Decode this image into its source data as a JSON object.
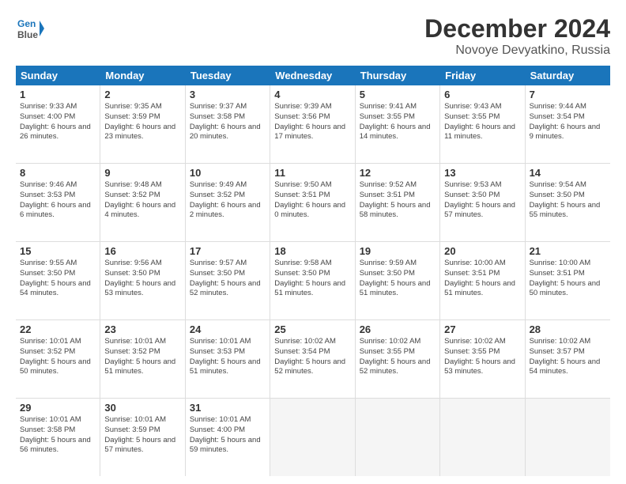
{
  "header": {
    "logo_line1": "General",
    "logo_line2": "Blue",
    "month_title": "December 2024",
    "location": "Novoye Devyatkino, Russia"
  },
  "weekdays": [
    "Sunday",
    "Monday",
    "Tuesday",
    "Wednesday",
    "Thursday",
    "Friday",
    "Saturday"
  ],
  "rows": [
    [
      {
        "day": "1",
        "sunrise": "Sunrise: 9:33 AM",
        "sunset": "Sunset: 4:00 PM",
        "daylight": "Daylight: 6 hours and 26 minutes."
      },
      {
        "day": "2",
        "sunrise": "Sunrise: 9:35 AM",
        "sunset": "Sunset: 3:59 PM",
        "daylight": "Daylight: 6 hours and 23 minutes."
      },
      {
        "day": "3",
        "sunrise": "Sunrise: 9:37 AM",
        "sunset": "Sunset: 3:58 PM",
        "daylight": "Daylight: 6 hours and 20 minutes."
      },
      {
        "day": "4",
        "sunrise": "Sunrise: 9:39 AM",
        "sunset": "Sunset: 3:56 PM",
        "daylight": "Daylight: 6 hours and 17 minutes."
      },
      {
        "day": "5",
        "sunrise": "Sunrise: 9:41 AM",
        "sunset": "Sunset: 3:55 PM",
        "daylight": "Daylight: 6 hours and 14 minutes."
      },
      {
        "day": "6",
        "sunrise": "Sunrise: 9:43 AM",
        "sunset": "Sunset: 3:55 PM",
        "daylight": "Daylight: 6 hours and 11 minutes."
      },
      {
        "day": "7",
        "sunrise": "Sunrise: 9:44 AM",
        "sunset": "Sunset: 3:54 PM",
        "daylight": "Daylight: 6 hours and 9 minutes."
      }
    ],
    [
      {
        "day": "8",
        "sunrise": "Sunrise: 9:46 AM",
        "sunset": "Sunset: 3:53 PM",
        "daylight": "Daylight: 6 hours and 6 minutes."
      },
      {
        "day": "9",
        "sunrise": "Sunrise: 9:48 AM",
        "sunset": "Sunset: 3:52 PM",
        "daylight": "Daylight: 6 hours and 4 minutes."
      },
      {
        "day": "10",
        "sunrise": "Sunrise: 9:49 AM",
        "sunset": "Sunset: 3:52 PM",
        "daylight": "Daylight: 6 hours and 2 minutes."
      },
      {
        "day": "11",
        "sunrise": "Sunrise: 9:50 AM",
        "sunset": "Sunset: 3:51 PM",
        "daylight": "Daylight: 6 hours and 0 minutes."
      },
      {
        "day": "12",
        "sunrise": "Sunrise: 9:52 AM",
        "sunset": "Sunset: 3:51 PM",
        "daylight": "Daylight: 5 hours and 58 minutes."
      },
      {
        "day": "13",
        "sunrise": "Sunrise: 9:53 AM",
        "sunset": "Sunset: 3:50 PM",
        "daylight": "Daylight: 5 hours and 57 minutes."
      },
      {
        "day": "14",
        "sunrise": "Sunrise: 9:54 AM",
        "sunset": "Sunset: 3:50 PM",
        "daylight": "Daylight: 5 hours and 55 minutes."
      }
    ],
    [
      {
        "day": "15",
        "sunrise": "Sunrise: 9:55 AM",
        "sunset": "Sunset: 3:50 PM",
        "daylight": "Daylight: 5 hours and 54 minutes."
      },
      {
        "day": "16",
        "sunrise": "Sunrise: 9:56 AM",
        "sunset": "Sunset: 3:50 PM",
        "daylight": "Daylight: 5 hours and 53 minutes."
      },
      {
        "day": "17",
        "sunrise": "Sunrise: 9:57 AM",
        "sunset": "Sunset: 3:50 PM",
        "daylight": "Daylight: 5 hours and 52 minutes."
      },
      {
        "day": "18",
        "sunrise": "Sunrise: 9:58 AM",
        "sunset": "Sunset: 3:50 PM",
        "daylight": "Daylight: 5 hours and 51 minutes."
      },
      {
        "day": "19",
        "sunrise": "Sunrise: 9:59 AM",
        "sunset": "Sunset: 3:50 PM",
        "daylight": "Daylight: 5 hours and 51 minutes."
      },
      {
        "day": "20",
        "sunrise": "Sunrise: 10:00 AM",
        "sunset": "Sunset: 3:51 PM",
        "daylight": "Daylight: 5 hours and 51 minutes."
      },
      {
        "day": "21",
        "sunrise": "Sunrise: 10:00 AM",
        "sunset": "Sunset: 3:51 PM",
        "daylight": "Daylight: 5 hours and 50 minutes."
      }
    ],
    [
      {
        "day": "22",
        "sunrise": "Sunrise: 10:01 AM",
        "sunset": "Sunset: 3:52 PM",
        "daylight": "Daylight: 5 hours and 50 minutes."
      },
      {
        "day": "23",
        "sunrise": "Sunrise: 10:01 AM",
        "sunset": "Sunset: 3:52 PM",
        "daylight": "Daylight: 5 hours and 51 minutes."
      },
      {
        "day": "24",
        "sunrise": "Sunrise: 10:01 AM",
        "sunset": "Sunset: 3:53 PM",
        "daylight": "Daylight: 5 hours and 51 minutes."
      },
      {
        "day": "25",
        "sunrise": "Sunrise: 10:02 AM",
        "sunset": "Sunset: 3:54 PM",
        "daylight": "Daylight: 5 hours and 52 minutes."
      },
      {
        "day": "26",
        "sunrise": "Sunrise: 10:02 AM",
        "sunset": "Sunset: 3:55 PM",
        "daylight": "Daylight: 5 hours and 52 minutes."
      },
      {
        "day": "27",
        "sunrise": "Sunrise: 10:02 AM",
        "sunset": "Sunset: 3:55 PM",
        "daylight": "Daylight: 5 hours and 53 minutes."
      },
      {
        "day": "28",
        "sunrise": "Sunrise: 10:02 AM",
        "sunset": "Sunset: 3:57 PM",
        "daylight": "Daylight: 5 hours and 54 minutes."
      }
    ],
    [
      {
        "day": "29",
        "sunrise": "Sunrise: 10:01 AM",
        "sunset": "Sunset: 3:58 PM",
        "daylight": "Daylight: 5 hours and 56 minutes."
      },
      {
        "day": "30",
        "sunrise": "Sunrise: 10:01 AM",
        "sunset": "Sunset: 3:59 PM",
        "daylight": "Daylight: 5 hours and 57 minutes."
      },
      {
        "day": "31",
        "sunrise": "Sunrise: 10:01 AM",
        "sunset": "Sunset: 4:00 PM",
        "daylight": "Daylight: 5 hours and 59 minutes."
      },
      null,
      null,
      null,
      null
    ]
  ]
}
